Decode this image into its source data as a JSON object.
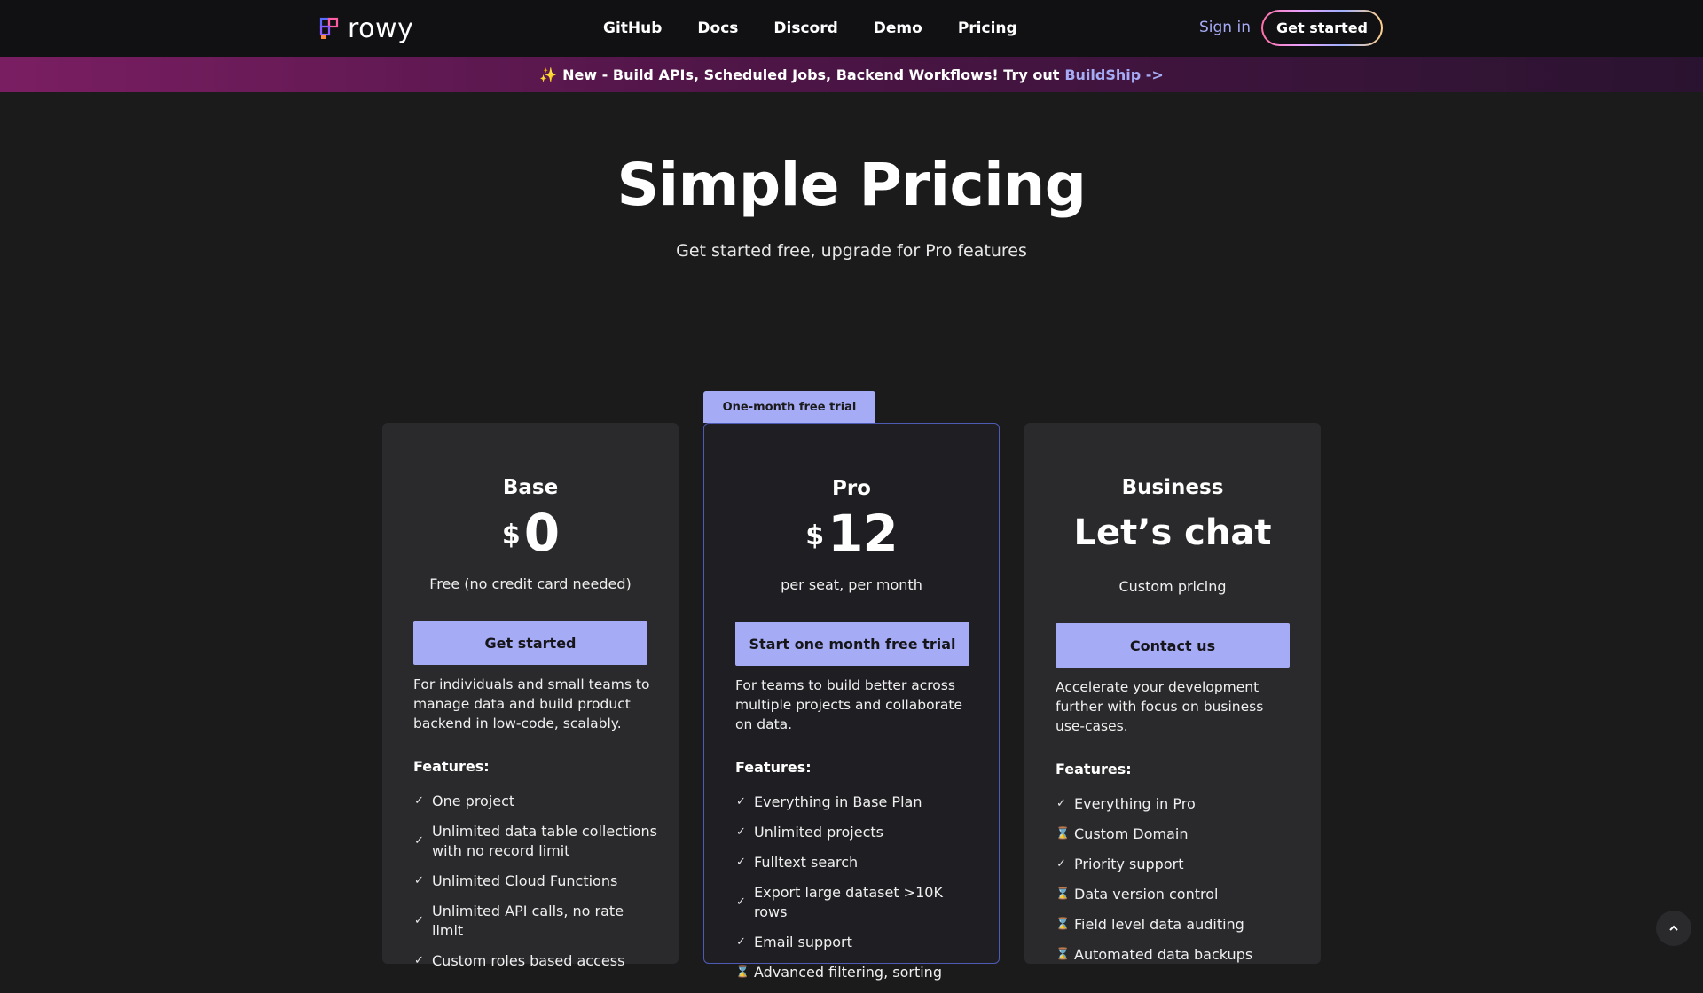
{
  "nav": {
    "logo_text": "rowy",
    "links": [
      "GitHub",
      "Docs",
      "Discord",
      "Demo",
      "Pricing"
    ],
    "signin": "Sign in",
    "get_started": "Get started"
  },
  "banner": {
    "spark_icon": "sparkles-icon",
    "text": "New - Build APIs, Scheduled Jobs, Backend Workflows! Try out",
    "link": "BuildShip ->"
  },
  "hero": {
    "title": "Simple Pricing",
    "subtitle": "Get started free, upgrade for Pro features"
  },
  "plans": [
    {
      "name": "Base",
      "currency": "$",
      "amount": "0",
      "note": "Free (no credit card needed)",
      "cta": "Get started",
      "description": "For individuals and small teams to manage data and build product backend in low-code, scalably.",
      "features_title": "Features:",
      "features": [
        {
          "icon": "check",
          "text": "One project"
        },
        {
          "icon": "check",
          "text": "Unlimited data table collections with no record limit"
        },
        {
          "icon": "check",
          "text": "Unlimited Cloud Functions"
        },
        {
          "icon": "check",
          "text": "Unlimited API calls, no rate limit"
        },
        {
          "icon": "check",
          "text": "Custom roles based access"
        }
      ]
    },
    {
      "name": "Pro",
      "badge": "One-month free trial",
      "currency": "$",
      "amount": "12",
      "note": "per seat, per month",
      "cta": "Start one month free trial",
      "description": "For teams to build better across multiple projects and collaborate on data.",
      "features_title": "Features:",
      "features": [
        {
          "icon": "check",
          "text": "Everything in Base Plan"
        },
        {
          "icon": "check",
          "text": "Unlimited projects"
        },
        {
          "icon": "check",
          "text": "Fulltext search"
        },
        {
          "icon": "check",
          "text": "Export large dataset >10K rows"
        },
        {
          "icon": "check",
          "text": "Email support"
        },
        {
          "icon": "hourglass",
          "text": "Advanced filtering, sorting"
        }
      ]
    },
    {
      "name": "Business",
      "amount_text": "Let’s chat",
      "note": "Custom pricing",
      "cta": "Contact us",
      "description": "Accelerate your development further with focus on business use-cases.",
      "features_title": "Features:",
      "features": [
        {
          "icon": "check",
          "text": "Everything in Pro"
        },
        {
          "icon": "hourglass",
          "text": "Custom Domain"
        },
        {
          "icon": "check",
          "text": "Priority support"
        },
        {
          "icon": "hourglass",
          "text": "Data version control"
        },
        {
          "icon": "hourglass",
          "text": "Field level data auditing"
        },
        {
          "icon": "hourglass",
          "text": "Automated data backups"
        }
      ]
    }
  ],
  "scroll_top_icon": "chevron-up-icon"
}
